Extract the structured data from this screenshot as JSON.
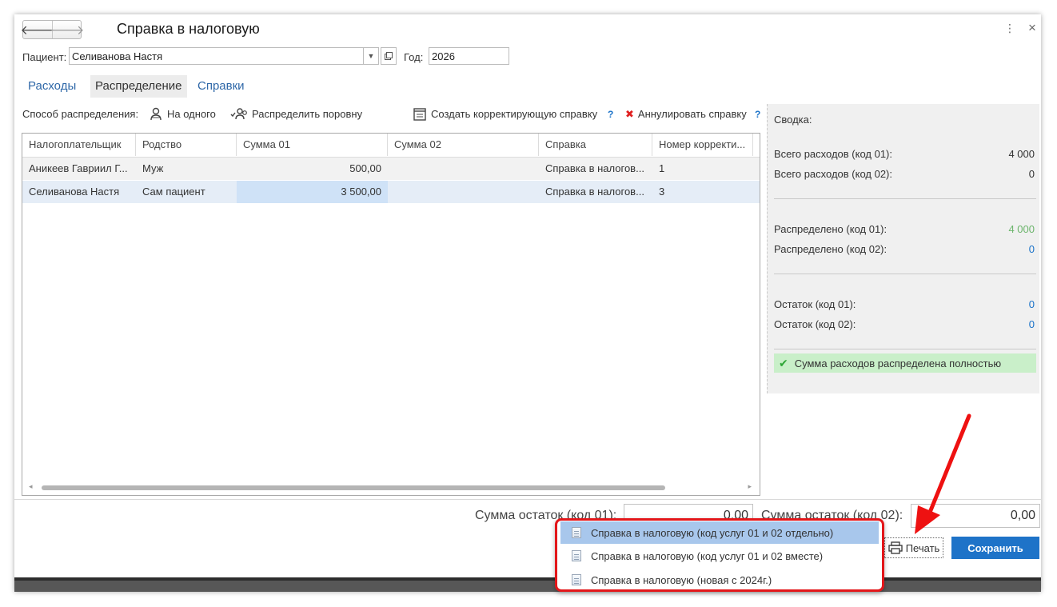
{
  "window": {
    "title": "Справка в налоговую",
    "back": "🡐",
    "forward": "🡒",
    "more": "⋮",
    "close": "×"
  },
  "patient": {
    "label": "Пациент:",
    "value": "Селиванова Настя"
  },
  "year": {
    "label": "Год:",
    "value": "2026"
  },
  "tabs": [
    {
      "label": "Расходы"
    },
    {
      "label": "Распределение"
    },
    {
      "label": "Справки"
    }
  ],
  "toolbar": {
    "method_label": "Способ распределения:",
    "one": "На одного",
    "evenly": "Распределить поровну",
    "create_correction": "Создать корректирующую справку",
    "cancel_cert": "Аннулировать справку",
    "help": "?"
  },
  "table": {
    "columns": [
      "Налогоплательщик",
      "Родство",
      "Сумма 01",
      "Сумма 02",
      "Справка",
      "Номер корректи..."
    ],
    "rows": [
      [
        "Аникеев Гавриил Г...",
        "Муж",
        "500,00",
        "",
        "Справка в налогов...",
        "1"
      ],
      [
        "Селиванова Настя",
        "Сам пациент",
        "3 500,00",
        "",
        "Справка в налогов...",
        "3"
      ]
    ]
  },
  "summary": {
    "title": "Сводка:",
    "total01_label": "Всего расходов (код 01):",
    "total01": "4 000",
    "total02_label": "Всего расходов (код 02):",
    "total02": "0",
    "dist01_label": "Распределено (код 01):",
    "dist01": "4 000",
    "dist02_label": "Распределено (код 02):",
    "dist02": "0",
    "rest01_label": "Остаток (код 01):",
    "rest01": "0",
    "rest02_label": "Остаток (код 02):",
    "rest02": "0",
    "status": "Сумма расходов распределена полностью",
    "colors": {
      "green": "#6cb56c",
      "blue": "#1b73c9"
    }
  },
  "bottom": {
    "rest01_label": "Сумма остаток (код 01):",
    "rest01": "0,00",
    "rest02_label": "Сумма остаток (код 02):",
    "rest02": "0,00",
    "print": "Печать",
    "save": "Сохранить"
  },
  "print_menu": [
    {
      "label": "Справка в налоговую (код услуг 01 и 02 отдельно)"
    },
    {
      "label": "Справка в налоговую (код услуг 01 и 02 вместе)"
    },
    {
      "label": "Справка в налоговую (новая с 2024г.)"
    }
  ],
  "accent": {
    "primary": "#1e73c8",
    "annotation": "#e3161a"
  }
}
